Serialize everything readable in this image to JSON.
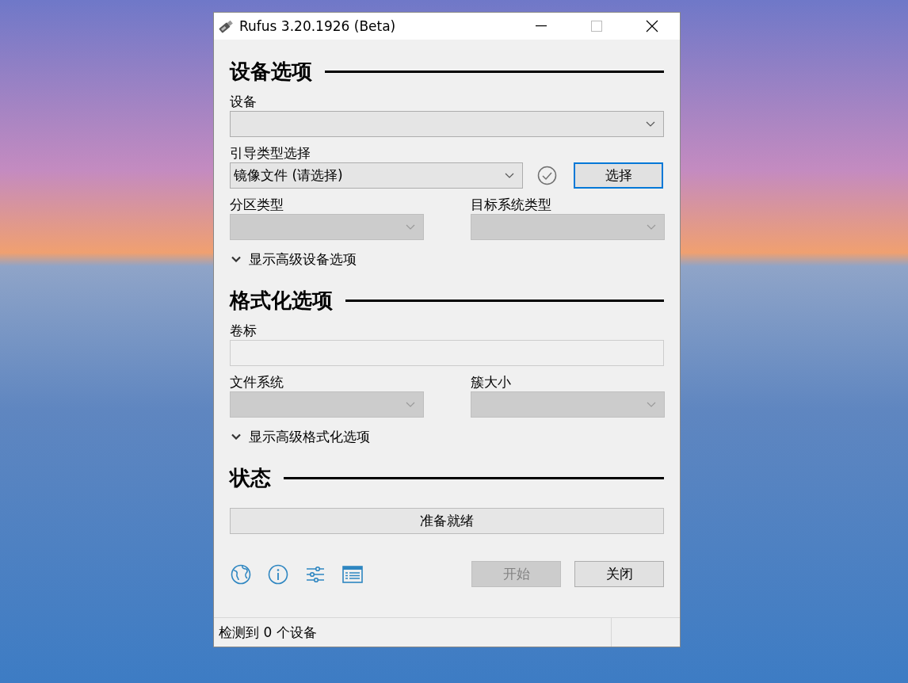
{
  "window": {
    "title": "Rufus 3.20.1926 (Beta)"
  },
  "sections": [
    {
      "title": "设备选项",
      "items": [
        {
          "kind": "dropdown",
          "label": "设备",
          "disabled": false
        },
        {
          "kind": "boot",
          "label": "引导类型选择",
          "value": "镜像文件 (请选择)",
          "button": "选择",
          "button_focused": true
        },
        {
          "kind": "pair",
          "fields": [
            {
              "label": "分区类型",
              "disabled": true
            },
            {
              "label": "目标系统类型",
              "disabled": true
            }
          ]
        },
        {
          "kind": "toggle",
          "label": "显示高级设备选项",
          "expanded": false
        }
      ]
    },
    {
      "title": "格式化选项",
      "items": [
        {
          "kind": "textbox",
          "label": "卷标",
          "disabled": true
        },
        {
          "kind": "pair",
          "fields": [
            {
              "label": "文件系统",
              "disabled": true
            },
            {
              "label": "簇大小",
              "disabled": true
            }
          ]
        },
        {
          "kind": "toggle",
          "label": "显示高级格式化选项",
          "expanded": false
        }
      ]
    },
    {
      "title": "状态",
      "items": [
        {
          "kind": "status",
          "text": "准备就绪",
          "level": 0
        }
      ]
    }
  ],
  "buttons": [
    {
      "label": "开始",
      "disabled": true
    },
    {
      "label": "关闭",
      "disabled": false
    }
  ],
  "status_bar": {
    "text": "检测到 0 个设备"
  }
}
